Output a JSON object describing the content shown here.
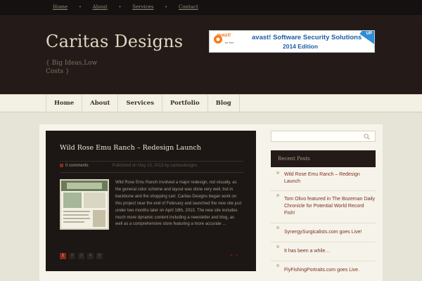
{
  "top_nav": [
    "Home",
    "About",
    "Services",
    "Contact"
  ],
  "site": {
    "title": "Caritas Designs",
    "tagline": "{ Big Ideas,Low Costs }"
  },
  "banner": {
    "brand": "avast!",
    "brand_sub": "be free",
    "line1": "avast! Software Security Solutions",
    "line2": "2014 Edition",
    "corner": "UP"
  },
  "main_nav": [
    "Home",
    "About",
    "Services",
    "Portfolio",
    "Blog"
  ],
  "post": {
    "title": "Wild Rose Emu Ranch – Redesign Launch",
    "comments": "0 comments",
    "meta": "Published on May 15, 2013 by caritasdesigns",
    "excerpt": "Wild Rose Emu Ranch involved a major redesign, not visually, as the general color scheme and layout was done very well, but in backbone and the shopping cart.  Caritas Designs began work on this project near the end of February and launched the new site just under two months later on April 18th, 2013.  The new site includes much more dynamic content including a newsletter and blog, as well as a comprehensive store featuring a more accurate ..."
  },
  "pager": {
    "pages": [
      "1",
      "2",
      "3",
      "4",
      "5"
    ],
    "active": "1",
    "arrows": "« »"
  },
  "sidebar": {
    "search_placeholder": "",
    "recent_title": "Recent Posts",
    "recent_posts": [
      "Wild Rose Emu Ranch – Redesign Launch",
      "Tom Olivo featured in The Bozeman Daily Chronicle for Potential World Record Fish!",
      "SynergySurgicalists.com goes Live!",
      "It has been a while…",
      "FlyFishingPortraits.com goes Live."
    ]
  },
  "colors": {
    "header_bg": "#241b19",
    "accent": "#8a2a1a",
    "link": "#7a2e1e"
  }
}
